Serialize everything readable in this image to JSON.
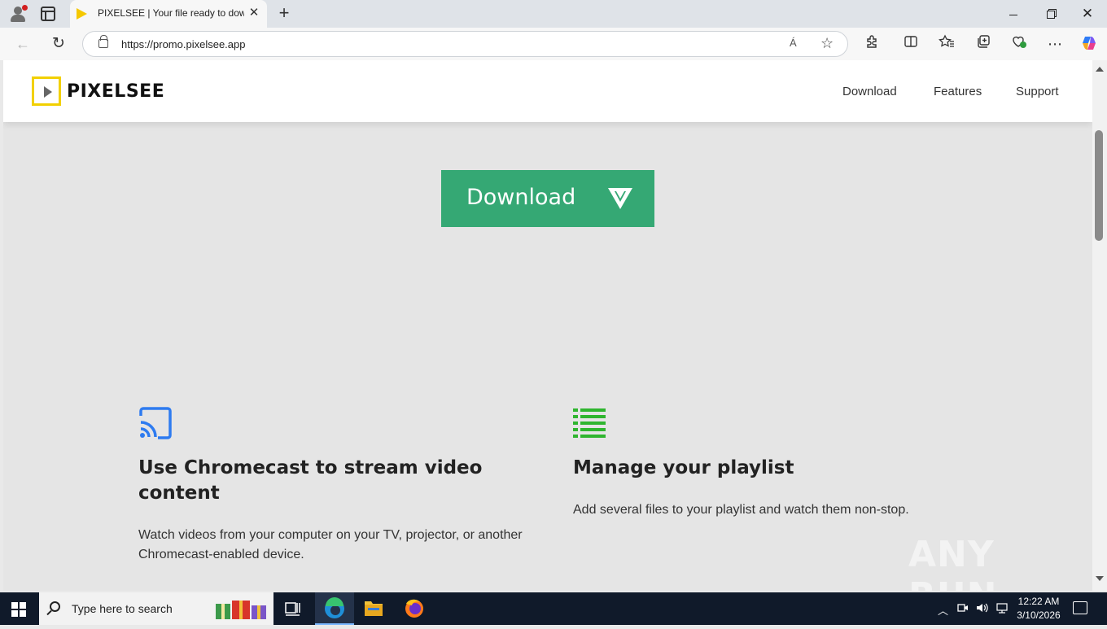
{
  "browser": {
    "tab_title": "PIXELSEE | Your file ready to download",
    "tab_close": "✕",
    "new_tab": "+",
    "url": "https://promo.pixelsee.app",
    "read_aloud": "Á",
    "window_close": "✕"
  },
  "site": {
    "logo": "PIXELSEE",
    "nav": [
      "Download",
      "Features",
      "Support"
    ],
    "download_button": "Download",
    "features": [
      {
        "title": "Use Chromecast to stream video content",
        "description": "Watch videos from your computer on your TV, projector, or another Chromecast-enabled device.",
        "icon": "cast-icon",
        "icon_color": "#2e7bf0"
      },
      {
        "title": "Manage your playlist",
        "description": "Add several files to your playlist and watch them non-stop.",
        "icon": "playlist-icon",
        "icon_color": "#2fb52f"
      }
    ],
    "accent_color": "#35a874",
    "logo_color": "#f2d000"
  },
  "watermark": "ANY RUN",
  "taskbar": {
    "search_placeholder": "Type here to search",
    "time": "12:22 AM",
    "date": "3/10/2026"
  }
}
